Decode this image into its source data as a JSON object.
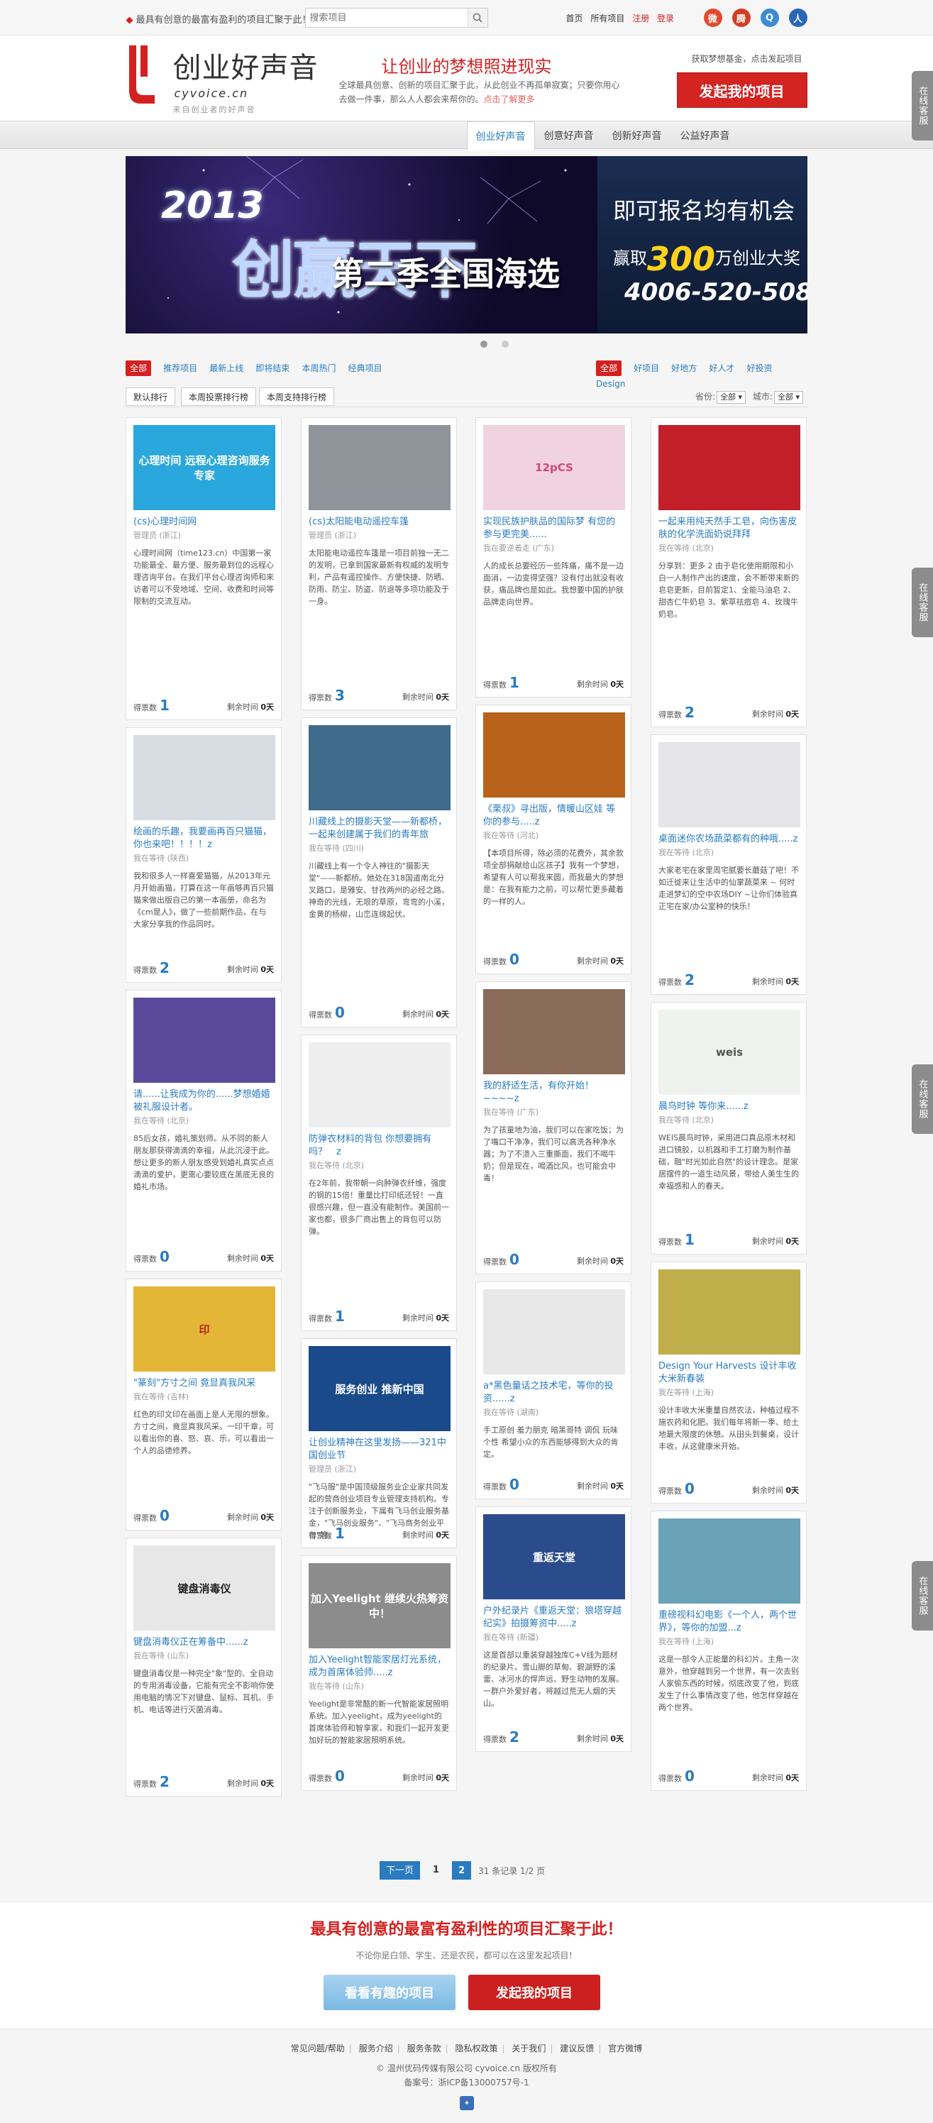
{
  "topbar": {
    "slogan": "最具有创意的最富有盈利的项目汇聚于此！",
    "search_placeholder": "搜索项目",
    "links": [
      "首页",
      "所有项目",
      "注册",
      "登录"
    ],
    "icons": [
      {
        "name": "weibo-icon",
        "glyph": "微",
        "color": "#e34a2b"
      },
      {
        "name": "tencent-weibo-icon",
        "glyph": "腾",
        "color": "#d43d25"
      },
      {
        "name": "qzone-icon",
        "glyph": "Q",
        "color": "#3b8bd4"
      },
      {
        "name": "renren-icon",
        "glyph": "人",
        "color": "#2a66b8"
      }
    ]
  },
  "header": {
    "logo_name": "创业好声音",
    "logo_domain": "cyvoice.cn",
    "logo_tag": "来自创业者的好声音",
    "headline": "让创业的梦想照进现实",
    "desc": "全球最具创意、创新的项目汇聚于此，从此创业不再孤单寂寞；只要你用心去做一件事，那么人人都会来帮你的。",
    "desc_link": "点击了解更多",
    "fund_label": "获取梦想基金，点击发起项目",
    "launch_btn": "发起我的项目"
  },
  "nav": [
    "创业好声音",
    "创意好声音",
    "创新好声音",
    "公益好声音"
  ],
  "banner": {
    "year": "2013",
    "big": "创赢天下",
    "season": "第二季全国海选",
    "right_line1": "即可报名均有机会",
    "right_prefix": "赢取",
    "right_amount": "300",
    "right_suffix": "万创业大奖",
    "phone": "4006-520-508"
  },
  "filters": {
    "left": [
      "全部",
      "推荐项目",
      "最新上线",
      "即将结束",
      "本周热门",
      "经典项目"
    ],
    "right": [
      "全部",
      "好项目",
      "好地方",
      "好人才",
      "好投资",
      "Design"
    ]
  },
  "sort": {
    "tabs": [
      "默认排行",
      "本周投票排行榜",
      "本周支持排行榜"
    ],
    "province_label": "省份:",
    "province_value": "全部",
    "city_label": "城市:",
    "city_value": "全部"
  },
  "labels": {
    "votes": "得票数",
    "remaining": "剩余时间",
    "days": "0天"
  },
  "cards": [
    {
      "title": "(cs)心理时间网",
      "author": "管理员 (浙江)",
      "desc": "心理时间网（time123.cn）中国第一家功能最全、最方便、服务最到位的远程心理咨询平台。在我们平台心理咨询师和来访者可以不受地域、空间、收费和时间等限制的交流互动。",
      "votes": "1",
      "pic_text": "心理时间 远程心理咨询服务专家",
      "pic_color": "#2aa7dc",
      "text_color": "#fff"
    },
    {
      "title": "(cs)太阳能电动遥控车篷",
      "author": "管理员 (浙江)",
      "desc": "太阳能电动遥控车篷是一项目前独一无二的发明，已拿到国家最新有权威的发明专利，产品有遥控操作、方便快捷、防晒、防雨、防尘、防盗、防退等多项功能及于一身。",
      "votes": "3",
      "pic_text": "",
      "pic_color": "#8f949b",
      "text_color": "#fff"
    },
    {
      "title": "实现民族护肤品的国际梦 有您的参与更完美......",
      "author": "我在要逆着走 (广东)",
      "desc": "人的成长总要经历一些阵痛，痛不是一边面消，一边变得坚强？没有付出就没有收获，痛品牌也是如此。我想要中国的护肤品牌走向世界。",
      "votes": "1",
      "pic_text": "12pCS",
      "pic_color": "#f1d3df",
      "text_color": "#d6457d"
    },
    {
      "title": "一起来用纯天然手工皂，向伤害皮肤的化学洗面奶说拜拜",
      "author": "我在等待 (北京)",
      "desc": "分享到：更多 2 由于皂化使用期限和小白一人制作产出的速度，会不断带来新的皂皂更新，目前暂定1、全能马油皂 2、甜杏仁牛奶皂 3、紫草祛痘皂 4、玫瑰牛奶皂。",
      "votes": "2",
      "pic_text": "",
      "pic_color": "#c21f2a",
      "text_color": "#fff"
    },
    {
      "title": "绘画的乐趣，我要画再百只猫猫，你也来吧！！！！z",
      "author": "我在等待 (陕西)",
      "desc": "我和很多人一样喜爱猫猫，从2013年元月开始画猫，打算在这一年画够再百只猫猫来做出版自己的第一本画册，命名为《cm是人》，做了一些前期作品，在与大家分享我的作品同时。",
      "votes": "2",
      "pic_text": "",
      "pic_color": "#d7dce2",
      "text_color": "#555"
    },
    {
      "title": "川藏线上的摄影天堂——新都桥，一起来创建属于我们的青年旅舍.....z",
      "author": "我在等待 (四川)",
      "desc": "川藏线上有一个令人神往的\"摄影天堂\"——新都桥。她处在318国道南北分叉路口，是雅安、甘孜两州的必经之路。神奇的光线，无垠的草原，弯弯的小溪，金黄的杨柳，山峦连绵起伏。",
      "votes": "0",
      "pic_text": "",
      "pic_color": "#3f6b8d",
      "text_color": "#fff"
    },
    {
      "title": "《栗叔》寻出版，情暖山区娃 等你的参与.....z",
      "author": "我在等待 (河北)",
      "desc": "【本项目所得，除必须的花费外，其余款项全部捐献给山区孩子】我有一个梦想，希望有人可以帮我来圆，而我最大的梦想是：在我有能力之前，可以帮忙更多藏着的一样的人。",
      "votes": "0",
      "pic_text": "",
      "pic_color": "#b8621a",
      "text_color": "#fff"
    },
    {
      "title": "桌面迷你农场蔬菜都有的种哦.....z",
      "author": "我在等待 (北京)",
      "desc": "大家老宅在家里周宅腻要长蘑菇了吧！不如迁徙来让生活中的仙掌蔬菜来 ~ 何时 走进梦幻的空中农场DIY ~让你们体验真正宅在家/办公室种的快乐！",
      "votes": "2",
      "pic_text": "",
      "pic_color": "#e6e6ea",
      "text_color": "#333"
    },
    {
      "title": "请......让我成为你的......梦想婚婚被礼服设计者。",
      "author": "我在等待 (北京)",
      "desc": "85后女孩，婚礼策划师。从不同的新人朋友那获得滴滴的幸福，从此沉浸于此。想让更多的新人朋友感受到婚礼真实点点滴滴的爱护，更需心要较底在黑底无良的婚礼市场。",
      "votes": "0",
      "pic_text": "",
      "pic_color": "#5b4a9c",
      "text_color": "#fff"
    },
    {
      "title": "防弹衣材料的背包 你想要拥有吗？　z",
      "author": "我在等待 (北京)",
      "desc": "在2年前，我带朝一向肿弹衣纤维，强度的钢的15倍！重量比打印纸还轻！一直很感兴趣，但一直没有能制作。美国前一家也都，很多厂商出售上的背包可以防弹。",
      "votes": "1",
      "pic_text": "",
      "pic_color": "#eeeeee",
      "text_color": "#999"
    },
    {
      "title": "我的舒适生活，有你开始！~~~~z",
      "author": "我在等待 (广东)",
      "desc": "为了孩童地为油，我们可以在家吃饭；为了嘴口干净净，我们可以高洗各种净水器；为了不溃入三重撕面，我们不喝牛奶；但是现在，喝酒比风，也可能会中毒！",
      "votes": "0",
      "pic_text": "",
      "pic_color": "#8a6a58",
      "text_color": "#fff"
    },
    {
      "title": "晨鸟时钟 等你来......z",
      "author": "我在等待 (北京)",
      "desc": "WEIS晨鸟时钟，采用进口真品原木材和进口镜胶，以机器和手工打磨为制作基础，融\"时光如此自然\"的设计理念。是家居摆件的一道生动风景，带给人美生生的幸福感和人的春天。",
      "votes": "1",
      "pic_text": "weis",
      "pic_color": "#f0f2f0",
      "text_color": "#555"
    },
    {
      "title": "\"篆刻\"方寸之间 竟显真我风采",
      "author": "我在等待 (吉林)",
      "desc": "红色的印文印在画面上是人无限的想象。方寸之间，竟显真我风采。一印千章，可以看出你的喜、怒、哀、乐，可以看出一个人的品德修养。",
      "votes": "0",
      "pic_text": "印",
      "pic_color": "#e4b636",
      "text_color": "#b22"
    },
    {
      "title": "让创业精神在这里发扬——321中国创业节",
      "author": "管理员 (浙江)",
      "desc": "\"飞马服\"是中国顶级服务业企业家共同发起的营商创业项目专业管理支持机构。专注于创新服务业，下属有飞马创业服务基金，\"飞马创业服务\"、\"飞马商务创业平台\"等。",
      "votes": "1",
      "pic_text": "服务创业 推新中国",
      "pic_color": "#1a4a8a",
      "text_color": "#fff"
    },
    {
      "title": "a*黑色量话之技术宅，等你的投资......z",
      "author": "我在等待 (湖南)",
      "desc": "手工原创 羞力朋克 暗黑哥特 调侃 玩味 个性 希望小众的东西能够得到大众的肯定。",
      "votes": "0",
      "pic_text": "",
      "pic_color": "#e8e8e8",
      "text_color": "#333"
    },
    {
      "title": "Design Your Harvests 设计丰收大米新春装",
      "author": "我在等待 (上海)",
      "desc": "设计丰收大米重量自然农法，种植过程不施农药和化肥。我们每年将新一季、给土地最大限度的休憩。从田头到餐桌，设计丰收，从这健康米开始。",
      "votes": "0",
      "pic_text": "",
      "pic_color": "#bfae4a",
      "text_color": "#fff"
    },
    {
      "title": "键盘消毒仪正在筹备中......z",
      "author": "我在等待 (山东)",
      "desc": "键盘消毒仪是一种完全\"象\"型的、全自动的专用消毒设备，它能有完全不影响你使用电脑的情况下对键盘、鼠标、耳机、手机、电话等进行灭菌消毒。",
      "votes": "2",
      "pic_text": "键盘消毒仪",
      "pic_color": "#e7e7e7",
      "text_color": "#222"
    },
    {
      "title": "加入Yeelight智能家居灯光系统，成为首席体验师.....z",
      "author": "我在等待 (山东)",
      "desc": "Yeelight是非常酷的新一代智能家居照明系统。加入yeelight，成为yeelight的首席体验师和智享家，和我们一起开发更加好玩的智能家居照明系统。",
      "votes": "0",
      "pic_text": "加入Yeelight 继续火热筹资中！",
      "pic_color": "#8c8c8c",
      "text_color": "#fff"
    },
    {
      "title": "户外纪录片《重返天堂：狼塔穿越纪实》拍摄筹资中.....z",
      "author": "我在等待 (新疆)",
      "desc": "这是首部以重装穿越独库C+V线为题材的纪录片。雪山脚的草甸、碧湖野的溪雷、冰河水的悍声远、野生动物的发展。一群户外爱好者，将越过荒无人烟的天山。",
      "votes": "2",
      "pic_text": "重返天堂",
      "pic_color": "#2a4c8c",
      "text_color": "#fff"
    },
    {
      "title": "重磅视科幻电影《一个人，两个世界》，等你的加盟...z",
      "author": "我在等待 (上海)",
      "desc": "这是一部令人正能量的科幻片。主角一次意外，他穿越到另一个世界，有一次去别人家偷东西的时候，彻底改变了他，到底发生了什么事情改变了他，他怎样穿越在两个世界。",
      "votes": "0",
      "pic_text": "",
      "pic_color": "#6aa3b8",
      "text_color": "#fff"
    }
  ],
  "pager": {
    "next": "下一页",
    "pages": [
      "1",
      "2"
    ],
    "summary": "31 条记录 1/2 页"
  },
  "cta": {
    "title": "最具有创意的最富有盈利性的项目汇聚于此！",
    "sub": "不论你是白领、学生、还是农民，都可以在这里发起项目！",
    "btn1": "看看有趣的项目",
    "btn2": "发起我的项目"
  },
  "footer": {
    "links": [
      "常见问题/帮助",
      "服务介绍",
      "服务条款",
      "隐私权政策",
      "关于我们",
      "建议反馈",
      "官方微博"
    ],
    "copyright": "© 温州优码传媒有限公司 cyvoice.cn 版权所有",
    "icp": "备案号：浙ICP备13000757号-1"
  },
  "side_tab": "在线客服",
  "colors": {
    "brand": "#d42020",
    "link": "#2a7bbf",
    "banner_accent": "#ffd21c"
  }
}
